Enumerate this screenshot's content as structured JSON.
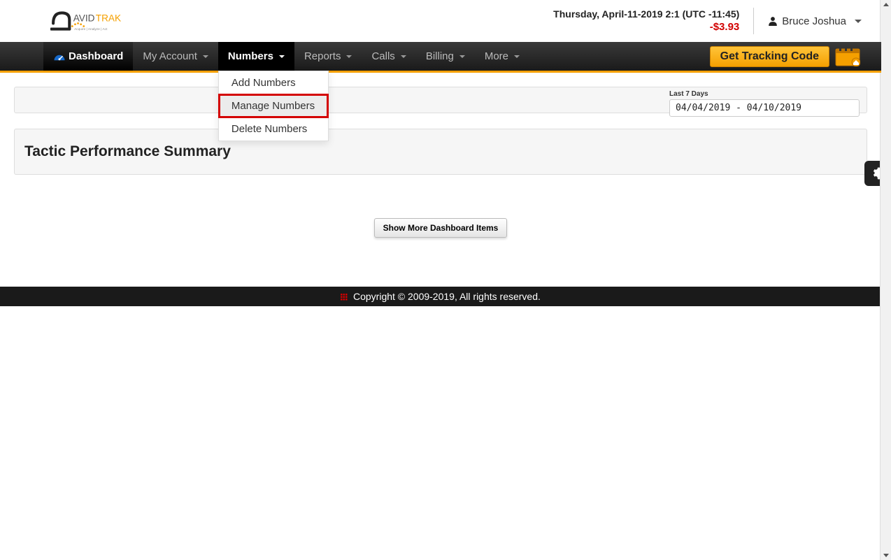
{
  "header": {
    "brand": {
      "name_left": "AVID",
      "name_right": "TRAK",
      "tagline": "Acquire  |  Analyze  |  Act"
    },
    "datetime": "Thursday, April-11-2019 2:1 (UTC -11:45)",
    "balance": "-$3.93",
    "user_name": "Bruce Joshua"
  },
  "nav": {
    "dashboard": "Dashboard",
    "my_account": "My Account",
    "numbers": "Numbers",
    "reports": "Reports",
    "calls": "Calls",
    "billing": "Billing",
    "more": "More",
    "tracking_button": "Get Tracking Code"
  },
  "numbers_dropdown": {
    "add": "Add Numbers",
    "manage": "Manage Numbers",
    "delete": "Delete Numbers"
  },
  "date_picker": {
    "label": "Last 7 Days",
    "value": "04/04/2019 - 04/10/2019"
  },
  "summary": {
    "title": "Tactic Performance Summary"
  },
  "show_more": "Show More Dashboard Items",
  "footer": {
    "copyright": "Copyright © 2009-2019, All rights reserved."
  }
}
